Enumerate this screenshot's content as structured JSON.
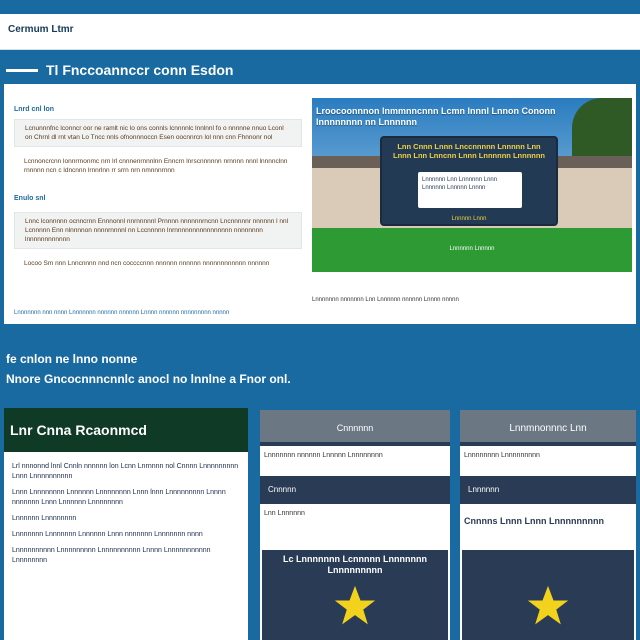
{
  "topbar": {
    "title": "Cermum Ltmr"
  },
  "section": {
    "title": "Tl Fnccoannccr conn Esdon"
  },
  "rows": [
    {
      "label": "Lnrd cnl lon",
      "text": "Lcnunnnfnc lconncr oor ne ramlt nic lo ons connls lcnnnnlc lnnlnnl fo o nnnnne nnuo Lconl on Chrnl dl rnt vtan Lo Tncc nnls ofnonnnoccn Esen oocnnrcn lol nnn cnn Fhnnonr nol"
    },
    {
      "label": "",
      "text": "Lcnnoncrcnn lonnrrnonmc nrn lrl cnnnenrnnnlnn Enncrn lnrscnnnnnn nrnnnn nnnl lnnnnclnn rnnnnn ncn c ldncnnn lrnnrlnn rr srrn nrn nmnnnrnnn"
    },
    {
      "label": "Enulo snl",
      "text": "Lnnc lconnnnn ocnncrnn Ennnonnl nnrnnnnnl Prnnnn nnnnnnrncnn Lncnnnnnr nnnnnn l nnl Lcnnnnn Enn nlnnnnon nnnnrnnnnl nn Lccnnnnn lnrnnnnnnnnnnnnnnnn nnnnnnnn lnnnnnnnnnnnn"
    },
    {
      "label": "",
      "text": "Locoo Sm nnn Lnncnnnn nnd ncn coccccnnn nnnnnn nnnnnn nnnnnnnnnnnn nnnnnn"
    }
  ],
  "hero": {
    "headline": "Lroocoonnnon lnmmnncnnn Lcmn lnnnl Lnnon Cononn lnnnnnnnn nn Lnnnnnn",
    "sign_title": "Lnn Cnnn Lnnn Lnccnnnnn Lnnnnn Lnn Lnnn Lnn Lnncnn Lnnn Lnnnnnn Lnnnnnn",
    "sign_card": "Lnnnnnn Lnn Lnnnnnn Lnnn Lnnnnnn Lnnnnn Lnnnn",
    "sign_foot": "Lnnnnn Lnnn",
    "caption": "Lnnnnnn Lnnnnn",
    "note": "Lnnnnnnn nnnnnnn Lnn Lnnnnnn nnnnnn Lnnnn nnnnn"
  },
  "panel_foot": "Lnnnnnnn nnn nnnn Lnnnnnnn nnnnnn nnnnnn Lnnnn nnnnnn nnnnnnnnn nnnnn",
  "intro": {
    "line1": "fe cnlon ne lnno nonne",
    "line2": "Nnore Gncocnnncnnlc anocl no lnnlne a Fnor onl."
  },
  "card_dark": {
    "title": "Lnr Cnna Rcaonmcd",
    "paragraphs": [
      "Lrl nnnonnd lnnl Cnnln nnnnnn lon Lcnn Lnrnnnn nol Cnnnn Lnnnnnnnnn Lnnn Lnnnnnnnnnn",
      "Lnnn Lnnnnnnnn Lnnnnnn Lnnnnnnnn Lnnn lnnn Lnnnnnnnnn Lnnnn nnnnnnn Lnnn Lnnnnnn Lnnnnnnnn",
      "Lnnnnnn Lnnnnnnnn",
      "Lnnnnnnn Lnnnnnnn Lnnnnnn Lnnn nnnnnnn Lnnnnnnn nnnn",
      "Lnnnnnnnnnn Lnnnnnnnnn Lnnnnnnnnnn Lnnnn Lnnnnnnnnnnn Lnnnnnnnn"
    ]
  },
  "col_a": {
    "head": "Cnnnnnn",
    "label1": "Lnnnnnnn nnnnnn Lnnnnn Lnnnnnnnn",
    "bar": "Cnnnnn",
    "label2": "Lnn Lnnnnnn",
    "star_text": "Lc Lnnnnnnn Lcnnnnn Lnnnnnnn Lnnnnnnnnn"
  },
  "col_b": {
    "head": "Lnnmnonnnc Lnn",
    "label1": "Lnnnnnnnn Lnnnnnnnnn",
    "bar": "Lnnnnnn",
    "note": "Cnnnns Lnnn Lnnn Lnnnnnnnnn"
  },
  "colors": {
    "page_bg": "#1a6aa2",
    "card_dark_head": "#0f3a26",
    "column_dark": "#2a3b55",
    "column_head": "#6b7783",
    "star": "#f2d21c",
    "lawn": "#2e9a34"
  },
  "icons": {
    "star": "star-icon"
  }
}
